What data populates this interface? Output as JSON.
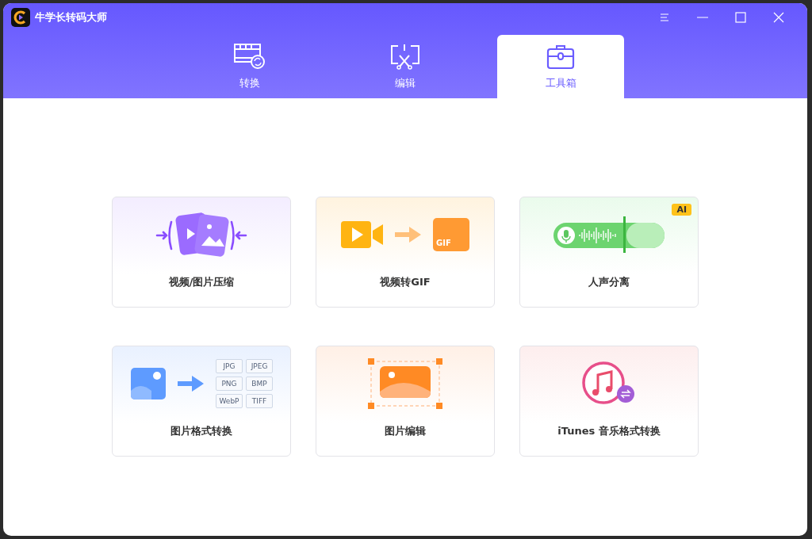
{
  "window": {
    "title": "牛学长转码大师"
  },
  "tabs": [
    {
      "kind": "convert",
      "label": "转换",
      "selected": false
    },
    {
      "kind": "edit",
      "label": "编辑",
      "selected": false
    },
    {
      "kind": "toolbox",
      "label": "工具箱",
      "selected": true
    }
  ],
  "tools": [
    {
      "kind": "compress",
      "label": "视频/图片压缩"
    },
    {
      "kind": "gif",
      "label": "视频转GIF",
      "tag": "GIF"
    },
    {
      "kind": "vocal",
      "label": "人声分离",
      "badge": "AI"
    },
    {
      "kind": "format",
      "label": "图片格式转换",
      "formats": [
        "JPG",
        "JPEG",
        "PNG",
        "BMP",
        "WebP",
        "TIFF"
      ]
    },
    {
      "kind": "imgedit",
      "label": "图片编辑"
    },
    {
      "kind": "itunes",
      "label": "iTunes 音乐格式转换"
    }
  ]
}
